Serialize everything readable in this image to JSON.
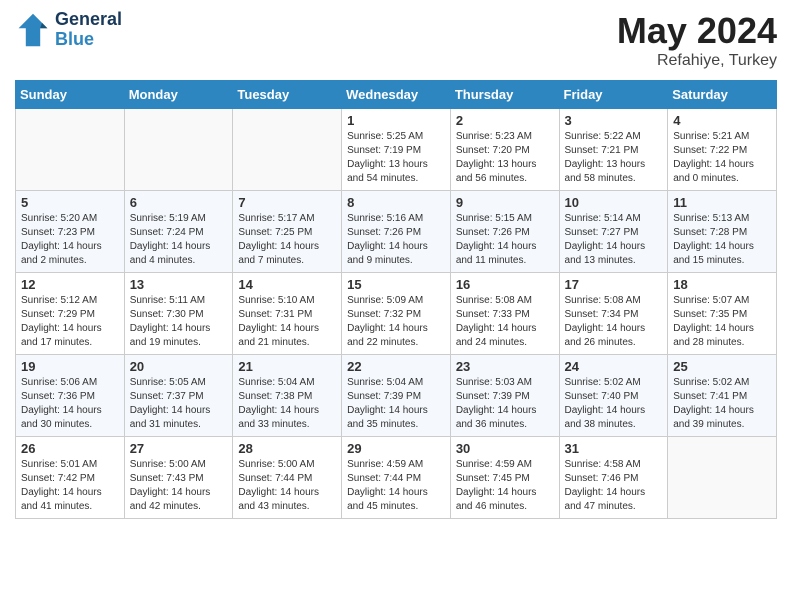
{
  "header": {
    "logo_line1": "General",
    "logo_line2": "Blue",
    "month": "May 2024",
    "location": "Refahiye, Turkey"
  },
  "weekdays": [
    "Sunday",
    "Monday",
    "Tuesday",
    "Wednesday",
    "Thursday",
    "Friday",
    "Saturday"
  ],
  "weeks": [
    [
      {
        "day": "",
        "info": ""
      },
      {
        "day": "",
        "info": ""
      },
      {
        "day": "",
        "info": ""
      },
      {
        "day": "1",
        "info": "Sunrise: 5:25 AM\nSunset: 7:19 PM\nDaylight: 13 hours\nand 54 minutes."
      },
      {
        "day": "2",
        "info": "Sunrise: 5:23 AM\nSunset: 7:20 PM\nDaylight: 13 hours\nand 56 minutes."
      },
      {
        "day": "3",
        "info": "Sunrise: 5:22 AM\nSunset: 7:21 PM\nDaylight: 13 hours\nand 58 minutes."
      },
      {
        "day": "4",
        "info": "Sunrise: 5:21 AM\nSunset: 7:22 PM\nDaylight: 14 hours\nand 0 minutes."
      }
    ],
    [
      {
        "day": "5",
        "info": "Sunrise: 5:20 AM\nSunset: 7:23 PM\nDaylight: 14 hours\nand 2 minutes."
      },
      {
        "day": "6",
        "info": "Sunrise: 5:19 AM\nSunset: 7:24 PM\nDaylight: 14 hours\nand 4 minutes."
      },
      {
        "day": "7",
        "info": "Sunrise: 5:17 AM\nSunset: 7:25 PM\nDaylight: 14 hours\nand 7 minutes."
      },
      {
        "day": "8",
        "info": "Sunrise: 5:16 AM\nSunset: 7:26 PM\nDaylight: 14 hours\nand 9 minutes."
      },
      {
        "day": "9",
        "info": "Sunrise: 5:15 AM\nSunset: 7:26 PM\nDaylight: 14 hours\nand 11 minutes."
      },
      {
        "day": "10",
        "info": "Sunrise: 5:14 AM\nSunset: 7:27 PM\nDaylight: 14 hours\nand 13 minutes."
      },
      {
        "day": "11",
        "info": "Sunrise: 5:13 AM\nSunset: 7:28 PM\nDaylight: 14 hours\nand 15 minutes."
      }
    ],
    [
      {
        "day": "12",
        "info": "Sunrise: 5:12 AM\nSunset: 7:29 PM\nDaylight: 14 hours\nand 17 minutes."
      },
      {
        "day": "13",
        "info": "Sunrise: 5:11 AM\nSunset: 7:30 PM\nDaylight: 14 hours\nand 19 minutes."
      },
      {
        "day": "14",
        "info": "Sunrise: 5:10 AM\nSunset: 7:31 PM\nDaylight: 14 hours\nand 21 minutes."
      },
      {
        "day": "15",
        "info": "Sunrise: 5:09 AM\nSunset: 7:32 PM\nDaylight: 14 hours\nand 22 minutes."
      },
      {
        "day": "16",
        "info": "Sunrise: 5:08 AM\nSunset: 7:33 PM\nDaylight: 14 hours\nand 24 minutes."
      },
      {
        "day": "17",
        "info": "Sunrise: 5:08 AM\nSunset: 7:34 PM\nDaylight: 14 hours\nand 26 minutes."
      },
      {
        "day": "18",
        "info": "Sunrise: 5:07 AM\nSunset: 7:35 PM\nDaylight: 14 hours\nand 28 minutes."
      }
    ],
    [
      {
        "day": "19",
        "info": "Sunrise: 5:06 AM\nSunset: 7:36 PM\nDaylight: 14 hours\nand 30 minutes."
      },
      {
        "day": "20",
        "info": "Sunrise: 5:05 AM\nSunset: 7:37 PM\nDaylight: 14 hours\nand 31 minutes."
      },
      {
        "day": "21",
        "info": "Sunrise: 5:04 AM\nSunset: 7:38 PM\nDaylight: 14 hours\nand 33 minutes."
      },
      {
        "day": "22",
        "info": "Sunrise: 5:04 AM\nSunset: 7:39 PM\nDaylight: 14 hours\nand 35 minutes."
      },
      {
        "day": "23",
        "info": "Sunrise: 5:03 AM\nSunset: 7:39 PM\nDaylight: 14 hours\nand 36 minutes."
      },
      {
        "day": "24",
        "info": "Sunrise: 5:02 AM\nSunset: 7:40 PM\nDaylight: 14 hours\nand 38 minutes."
      },
      {
        "day": "25",
        "info": "Sunrise: 5:02 AM\nSunset: 7:41 PM\nDaylight: 14 hours\nand 39 minutes."
      }
    ],
    [
      {
        "day": "26",
        "info": "Sunrise: 5:01 AM\nSunset: 7:42 PM\nDaylight: 14 hours\nand 41 minutes."
      },
      {
        "day": "27",
        "info": "Sunrise: 5:00 AM\nSunset: 7:43 PM\nDaylight: 14 hours\nand 42 minutes."
      },
      {
        "day": "28",
        "info": "Sunrise: 5:00 AM\nSunset: 7:44 PM\nDaylight: 14 hours\nand 43 minutes."
      },
      {
        "day": "29",
        "info": "Sunrise: 4:59 AM\nSunset: 7:44 PM\nDaylight: 14 hours\nand 45 minutes."
      },
      {
        "day": "30",
        "info": "Sunrise: 4:59 AM\nSunset: 7:45 PM\nDaylight: 14 hours\nand 46 minutes."
      },
      {
        "day": "31",
        "info": "Sunrise: 4:58 AM\nSunset: 7:46 PM\nDaylight: 14 hours\nand 47 minutes."
      },
      {
        "day": "",
        "info": ""
      }
    ]
  ]
}
